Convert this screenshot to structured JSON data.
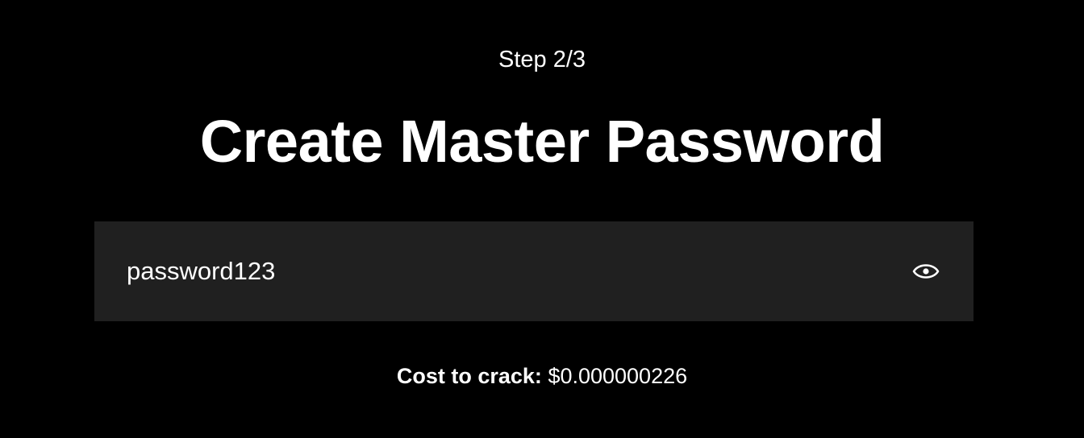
{
  "step": {
    "label": "Step 2/3"
  },
  "heading": {
    "title": "Create Master Password"
  },
  "password_field": {
    "value": "password123",
    "visibility_icon": "eye-icon"
  },
  "cost": {
    "label": "Cost to crack:",
    "value": "$0.000000226"
  },
  "colors": {
    "background": "#000000",
    "field_background": "#202020",
    "text": "#ffffff"
  }
}
